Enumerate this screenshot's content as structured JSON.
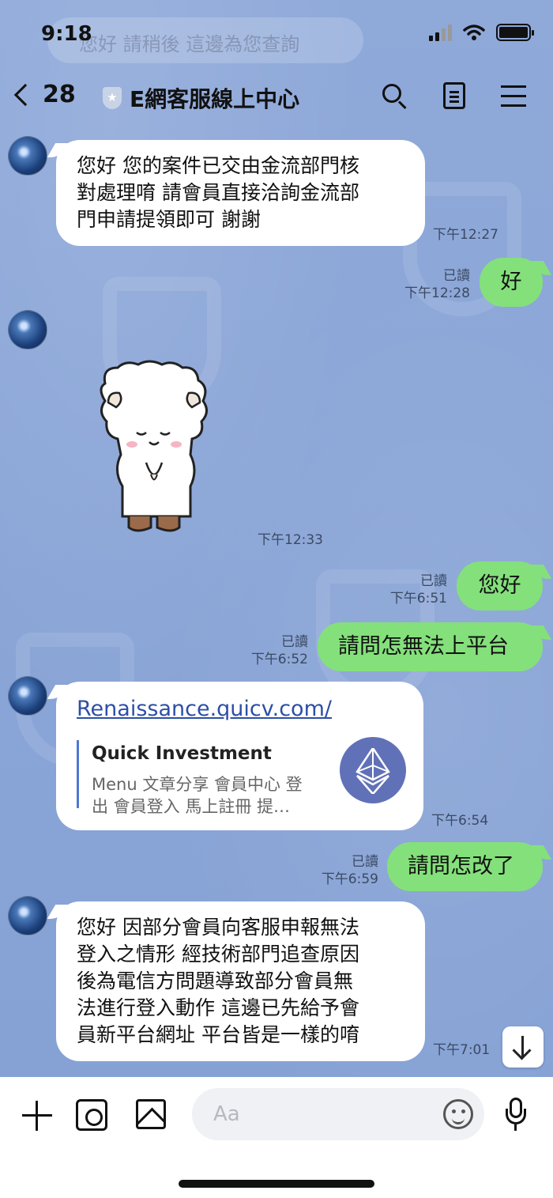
{
  "status_bar": {
    "time": "9:18"
  },
  "ghost_banner": {
    "text": "您好 請稍後 這邊為您查詢"
  },
  "header": {
    "back_count": "28",
    "title": "E網客服線上中心"
  },
  "messages": [
    {
      "side": "left",
      "text": [
        "您好 您的案件已交由金流部門核",
        "對處理唷 請會員直接洽詢金流部",
        "門申請提領即可 謝謝"
      ],
      "time": "下午12:27"
    },
    {
      "side": "right",
      "text": "好",
      "read": "已讀",
      "time": "下午12:28"
    },
    {
      "side": "left",
      "type": "sticker",
      "time": "下午12:33"
    },
    {
      "side": "right",
      "text": "您好",
      "read": "已讀",
      "time": "下午6:51"
    },
    {
      "side": "right",
      "text": "請問怎無法上平台",
      "read": "已讀",
      "time": "下午6:52"
    },
    {
      "side": "left",
      "type": "link",
      "url": "Renaissance.quicv.com/",
      "preview_title": "Quick Investment",
      "preview_desc": [
        "Menu 文章分享 會員中心 登",
        "出 會員登入 馬上註冊 提…"
      ],
      "time": "下午6:54"
    },
    {
      "side": "right",
      "text": "請問怎改了",
      "read": "已讀",
      "time": "下午6:59"
    },
    {
      "side": "left",
      "text": [
        "您好 因部分會員向客服申報無法",
        "登入之情形 經技術部門追查原因",
        "後為電信方問題導致部分會員無",
        "法進行登入動作 這邊已先給予會",
        "員新平台網址 平台皆是一樣的唷"
      ],
      "time": "下午7:01"
    }
  ],
  "input": {
    "placeholder": "Aa"
  },
  "icons": [
    "back-chevron-icon",
    "shield-icon",
    "search-icon",
    "notes-icon",
    "menu-icon",
    "scroll-down-icon",
    "plus-icon",
    "camera-icon",
    "gallery-icon",
    "emoji-icon",
    "mic-icon",
    "ethereum-icon"
  ],
  "colors": {
    "background": "#8aa7d8",
    "outgoing_bubble": "#84e07b",
    "incoming_bubble": "#ffffff",
    "link": "#2c4fa6"
  }
}
